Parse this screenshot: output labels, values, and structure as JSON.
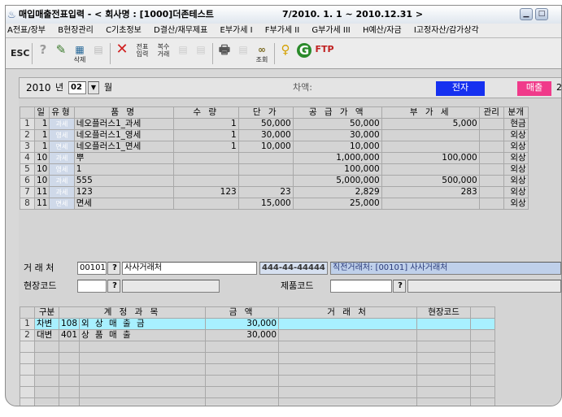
{
  "window": {
    "title": "매입매출전표입력 - < 회사명 : [1000]더존테스트",
    "period": "7/2010. 1. 1 ~ 2010.12.31 >"
  },
  "menu": [
    "A전표/장부",
    "B현장관리",
    "C기초정보",
    "D결산/재무제표",
    "E부가세 I",
    "F부가세 II",
    "G부가세 III",
    "H예산/자금",
    "I고정자산/감가상각"
  ],
  "toolbar": {
    "esc": "ESC",
    "btn_delete": "삭제",
    "btn_jeonpyo": "전표 입력",
    "btn_bok": "복수 거래",
    "btn_print": "인쇄",
    "btn_lookup": "조회"
  },
  "header": {
    "year": "2010",
    "year_unit": "년",
    "month": "02",
    "month_unit": "월",
    "chaek_label": "차액:",
    "jeonja_badge": "전자",
    "maechul_badge": "매출",
    "trailing_num": "2"
  },
  "grid1": {
    "columns": [
      "일",
      "유형",
      "품      명",
      "수      량",
      "단      가",
      "공 급 가 액",
      "부  가  세",
      "관리",
      "분개"
    ],
    "rows": [
      {
        "no": "1",
        "day": "1",
        "type": "과세",
        "name": "네오플러스1_과세",
        "qty": "1",
        "price": "50,000",
        "supply": "50,000",
        "vat": "5,000",
        "mgmt": "",
        "split": "현금"
      },
      {
        "no": "2",
        "day": "1",
        "type": "영세",
        "name": "네오플러스1_영세",
        "qty": "1",
        "price": "30,000",
        "supply": "30,000",
        "vat": "",
        "mgmt": "",
        "split": "외상"
      },
      {
        "no": "3",
        "day": "1",
        "type": "면세",
        "name": "네오플러스1_면세",
        "qty": "1",
        "price": "10,000",
        "supply": "10,000",
        "vat": "",
        "mgmt": "",
        "split": "외상"
      },
      {
        "no": "4",
        "day": "10",
        "type": "과세",
        "name": "뿌",
        "qty": "",
        "price": "",
        "supply": "1,000,000",
        "vat": "100,000",
        "mgmt": "",
        "split": "외상"
      },
      {
        "no": "5",
        "day": "10",
        "type": "영세",
        "name": "1",
        "qty": "",
        "price": "",
        "supply": "100,000",
        "vat": "",
        "mgmt": "",
        "split": "외상"
      },
      {
        "no": "6",
        "day": "10",
        "type": "과세",
        "name": "555",
        "qty": "",
        "price": "",
        "supply": "5,000,000",
        "vat": "500,000",
        "mgmt": "",
        "split": "외상"
      },
      {
        "no": "7",
        "day": "11",
        "type": "과세",
        "name": "123",
        "qty": "123",
        "price": "23",
        "supply": "2,829",
        "vat": "283",
        "mgmt": "",
        "split": "외상"
      },
      {
        "no": "8",
        "day": "11",
        "type": "면세",
        "name": "면세",
        "qty": "",
        "price": "15,000",
        "supply": "25,000",
        "vat": "",
        "mgmt": "",
        "split": "외상"
      }
    ]
  },
  "partner": {
    "label": "거 래 처",
    "code": "00101",
    "help": "?",
    "name": "사사거래처",
    "bizno": "444-44-44444",
    "direct": "직전거래처: [00101]  사사거래처"
  },
  "site": {
    "label": "현장코드",
    "help": "?",
    "product_label": "제품코드",
    "product_help": "?"
  },
  "grid2": {
    "columns": [
      "구분",
      "계 정 과 목",
      "금      액",
      "거    래    처",
      "현장코드"
    ],
    "rows": [
      {
        "no": "1",
        "kind": "차변",
        "code": "108",
        "account": "외 상 매 출 금",
        "amount": "30,000",
        "partner": "",
        "site": ""
      },
      {
        "no": "2",
        "kind": "대변",
        "code": "401",
        "account": "상   품   매   출",
        "amount": "30,000",
        "partner": "",
        "site": ""
      }
    ],
    "empty_rows": 6
  },
  "colors": {
    "jeonja": "#1530f0",
    "maechul": "#f03a8a",
    "selected_row": "#a8f0ff",
    "type_cell": "#cdd8ea"
  }
}
